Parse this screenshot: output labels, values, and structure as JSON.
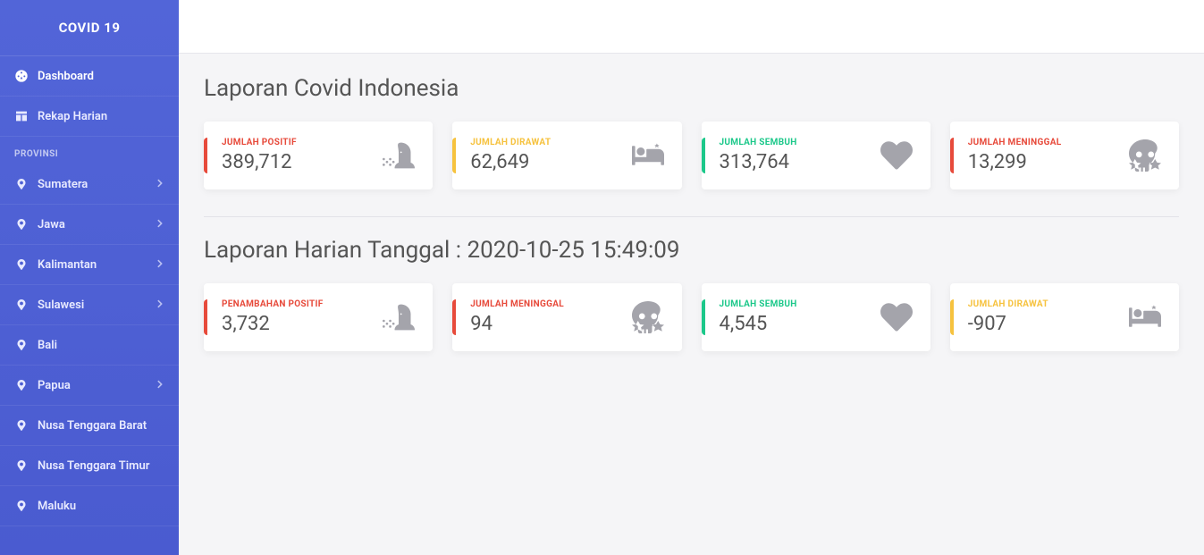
{
  "sidebar": {
    "title": "COVID 19",
    "nav": [
      {
        "label": "Dashboard"
      },
      {
        "label": "Rekap Harian"
      }
    ],
    "provinsi_header": "PROVINSI",
    "provinsi": [
      {
        "label": "Sumatera",
        "expandable": true
      },
      {
        "label": "Jawa",
        "expandable": true
      },
      {
        "label": "Kalimantan",
        "expandable": true
      },
      {
        "label": "Sulawesi",
        "expandable": true
      },
      {
        "label": "Bali",
        "expandable": false
      },
      {
        "label": "Papua",
        "expandable": true
      },
      {
        "label": "Nusa Tenggara Barat",
        "expandable": false
      },
      {
        "label": "Nusa Tenggara Timur",
        "expandable": false
      },
      {
        "label": "Maluku",
        "expandable": false
      }
    ]
  },
  "main": {
    "section1_title": "Laporan Covid Indonesia",
    "section2_title": "Laporan Harian Tanggal : 2020-10-25 15:49:09",
    "cards1": [
      {
        "label": "JUMLAH POSITIF",
        "value": "389,712",
        "color": "red",
        "icon": "cough"
      },
      {
        "label": "JUMLAH DIRAWAT",
        "value": "62,649",
        "color": "orange",
        "icon": "bed"
      },
      {
        "label": "JUMLAH SEMBUH",
        "value": "313,764",
        "color": "green",
        "icon": "heart"
      },
      {
        "label": "JUMLAH MENINGGAL",
        "value": "13,299",
        "color": "red",
        "icon": "skull"
      }
    ],
    "cards2": [
      {
        "label": "PENAMBAHAN POSITIF",
        "value": "3,732",
        "color": "red",
        "icon": "cough"
      },
      {
        "label": "JUMLAH MENINGGAL",
        "value": "94",
        "color": "red",
        "icon": "skull"
      },
      {
        "label": "JUMLAH SEMBUH",
        "value": "4,545",
        "color": "green",
        "icon": "heart"
      },
      {
        "label": "JUMLAH DIRAWAT",
        "value": "-907",
        "color": "orange",
        "icon": "bed"
      }
    ]
  }
}
